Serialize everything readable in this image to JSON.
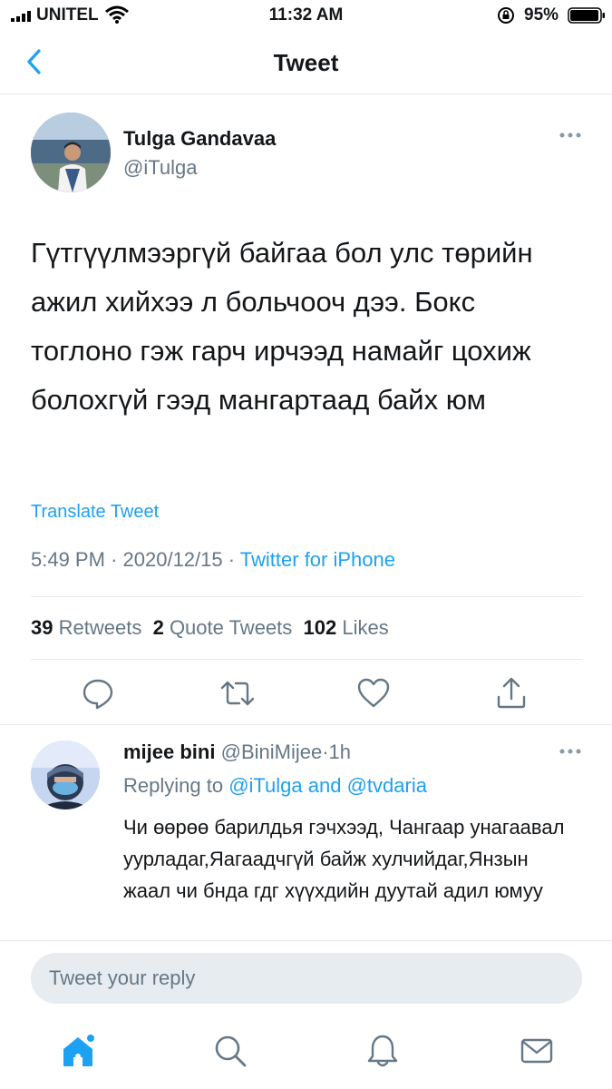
{
  "status_bar": {
    "carrier": "UNITEL",
    "time": "11:32 AM",
    "battery": "95%"
  },
  "nav": {
    "title": "Tweet"
  },
  "tweet": {
    "author_name": "Tulga Gandavaa",
    "author_handle": "@iTulga",
    "text": "Гүтгүүлмээргүй байгаа бол улс төрийн ажил хийхээ л больчооч дээ. Бокс тоглоно гэж гарч ирчээд намайг цохиж болохгүй гээд мангартаад байх юм",
    "translate_label": "Translate Tweet",
    "time": "5:49 PM",
    "date": "2020/12/15",
    "separator": "·",
    "source": "Twitter for iPhone",
    "stats": {
      "retweets_count": "39",
      "retweets_label": "Retweets",
      "quotes_count": "2",
      "quotes_label": "Quote Tweets",
      "likes_count": "102",
      "likes_label": "Likes"
    }
  },
  "reply": {
    "name": "mijee bini",
    "handle": "@BiniMijee",
    "separator": "·",
    "age": "1h",
    "replying_prefix": "Replying to",
    "replying_to": "@iTulga and @tvdaria",
    "text": "Чи өөрөө барилдья гэчхээд, Чангаар унагаавал уурладаг,Яагаадчгүй байж хулчийдаг,Янзын жаал чи бнда гдг хүүхдийн дуутай адил юмуу"
  },
  "composer": {
    "placeholder": "Tweet your reply"
  },
  "colors": {
    "accent": "#1da1f2",
    "secondary_text": "#657786",
    "divider": "#e1e8ed"
  },
  "icons": [
    "signal-icon",
    "wifi-icon",
    "lock-rotation-icon",
    "battery-icon",
    "back-chevron-icon",
    "more-icon",
    "reply-icon",
    "retweet-icon",
    "like-icon",
    "share-icon",
    "home-icon",
    "search-icon",
    "notifications-icon",
    "messages-icon"
  ]
}
